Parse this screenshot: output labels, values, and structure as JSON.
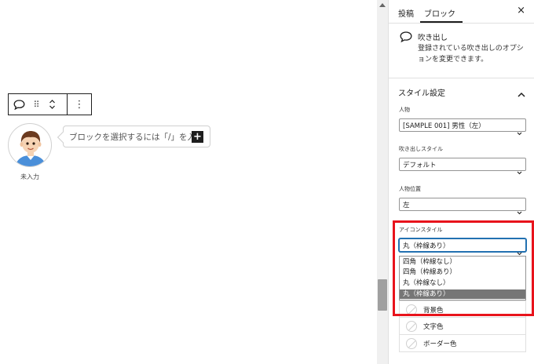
{
  "editor": {
    "balloon_placeholder": "ブロックを選択するには「/」を入力",
    "inserter_label": "+",
    "avatar_name": "未入力"
  },
  "sidebar": {
    "tabs": [
      "投稿",
      "ブロック"
    ],
    "close_label": "×",
    "block_card": {
      "icon": "speech-bubble-icon",
      "title": "吹き出し",
      "description": "登録されている吹き出しのオプションを変更できます。"
    },
    "panel": {
      "title": "スタイル設定",
      "expanded": true
    },
    "fields": [
      {
        "label": "人物",
        "value": "[SAMPLE 001] 男性（左）"
      },
      {
        "label": "吹き出しスタイル",
        "value": "デフォルト"
      },
      {
        "label": "人物位置",
        "value": "左"
      },
      {
        "label": "アイコンスタイル",
        "value": "丸（枠線あり）"
      }
    ],
    "icon_style_options": [
      {
        "label": "四角（枠線なし）",
        "selected": false
      },
      {
        "label": "四角（枠線あり）",
        "selected": false
      },
      {
        "label": "丸（枠線なし）",
        "selected": false
      },
      {
        "label": "丸（枠線あり）",
        "selected": true
      }
    ],
    "colors": [
      "背景色",
      "文字色",
      "ボーダー色"
    ]
  },
  "colors": {
    "highlight": "#e8131b",
    "focus": "#2271b1",
    "selected_option_bg": "#767676"
  }
}
